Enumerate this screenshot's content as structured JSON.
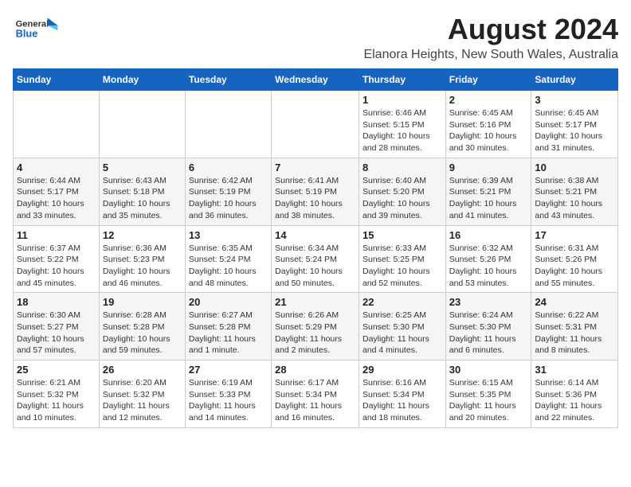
{
  "logo": {
    "text_general": "General",
    "text_blue": "Blue"
  },
  "title": "August 2024",
  "subtitle": "Elanora Heights, New South Wales, Australia",
  "days_of_week": [
    "Sunday",
    "Monday",
    "Tuesday",
    "Wednesday",
    "Thursday",
    "Friday",
    "Saturday"
  ],
  "weeks": [
    [
      {
        "day": "",
        "info": ""
      },
      {
        "day": "",
        "info": ""
      },
      {
        "day": "",
        "info": ""
      },
      {
        "day": "",
        "info": ""
      },
      {
        "day": "1",
        "info": "Sunrise: 6:46 AM\nSunset: 5:15 PM\nDaylight: 10 hours\nand 28 minutes."
      },
      {
        "day": "2",
        "info": "Sunrise: 6:45 AM\nSunset: 5:16 PM\nDaylight: 10 hours\nand 30 minutes."
      },
      {
        "day": "3",
        "info": "Sunrise: 6:45 AM\nSunset: 5:17 PM\nDaylight: 10 hours\nand 31 minutes."
      }
    ],
    [
      {
        "day": "4",
        "info": "Sunrise: 6:44 AM\nSunset: 5:17 PM\nDaylight: 10 hours\nand 33 minutes."
      },
      {
        "day": "5",
        "info": "Sunrise: 6:43 AM\nSunset: 5:18 PM\nDaylight: 10 hours\nand 35 minutes."
      },
      {
        "day": "6",
        "info": "Sunrise: 6:42 AM\nSunset: 5:19 PM\nDaylight: 10 hours\nand 36 minutes."
      },
      {
        "day": "7",
        "info": "Sunrise: 6:41 AM\nSunset: 5:19 PM\nDaylight: 10 hours\nand 38 minutes."
      },
      {
        "day": "8",
        "info": "Sunrise: 6:40 AM\nSunset: 5:20 PM\nDaylight: 10 hours\nand 39 minutes."
      },
      {
        "day": "9",
        "info": "Sunrise: 6:39 AM\nSunset: 5:21 PM\nDaylight: 10 hours\nand 41 minutes."
      },
      {
        "day": "10",
        "info": "Sunrise: 6:38 AM\nSunset: 5:21 PM\nDaylight: 10 hours\nand 43 minutes."
      }
    ],
    [
      {
        "day": "11",
        "info": "Sunrise: 6:37 AM\nSunset: 5:22 PM\nDaylight: 10 hours\nand 45 minutes."
      },
      {
        "day": "12",
        "info": "Sunrise: 6:36 AM\nSunset: 5:23 PM\nDaylight: 10 hours\nand 46 minutes."
      },
      {
        "day": "13",
        "info": "Sunrise: 6:35 AM\nSunset: 5:24 PM\nDaylight: 10 hours\nand 48 minutes."
      },
      {
        "day": "14",
        "info": "Sunrise: 6:34 AM\nSunset: 5:24 PM\nDaylight: 10 hours\nand 50 minutes."
      },
      {
        "day": "15",
        "info": "Sunrise: 6:33 AM\nSunset: 5:25 PM\nDaylight: 10 hours\nand 52 minutes."
      },
      {
        "day": "16",
        "info": "Sunrise: 6:32 AM\nSunset: 5:26 PM\nDaylight: 10 hours\nand 53 minutes."
      },
      {
        "day": "17",
        "info": "Sunrise: 6:31 AM\nSunset: 5:26 PM\nDaylight: 10 hours\nand 55 minutes."
      }
    ],
    [
      {
        "day": "18",
        "info": "Sunrise: 6:30 AM\nSunset: 5:27 PM\nDaylight: 10 hours\nand 57 minutes."
      },
      {
        "day": "19",
        "info": "Sunrise: 6:28 AM\nSunset: 5:28 PM\nDaylight: 10 hours\nand 59 minutes."
      },
      {
        "day": "20",
        "info": "Sunrise: 6:27 AM\nSunset: 5:28 PM\nDaylight: 11 hours\nand 1 minute."
      },
      {
        "day": "21",
        "info": "Sunrise: 6:26 AM\nSunset: 5:29 PM\nDaylight: 11 hours\nand 2 minutes."
      },
      {
        "day": "22",
        "info": "Sunrise: 6:25 AM\nSunset: 5:30 PM\nDaylight: 11 hours\nand 4 minutes."
      },
      {
        "day": "23",
        "info": "Sunrise: 6:24 AM\nSunset: 5:30 PM\nDaylight: 11 hours\nand 6 minutes."
      },
      {
        "day": "24",
        "info": "Sunrise: 6:22 AM\nSunset: 5:31 PM\nDaylight: 11 hours\nand 8 minutes."
      }
    ],
    [
      {
        "day": "25",
        "info": "Sunrise: 6:21 AM\nSunset: 5:32 PM\nDaylight: 11 hours\nand 10 minutes."
      },
      {
        "day": "26",
        "info": "Sunrise: 6:20 AM\nSunset: 5:32 PM\nDaylight: 11 hours\nand 12 minutes."
      },
      {
        "day": "27",
        "info": "Sunrise: 6:19 AM\nSunset: 5:33 PM\nDaylight: 11 hours\nand 14 minutes."
      },
      {
        "day": "28",
        "info": "Sunrise: 6:17 AM\nSunset: 5:34 PM\nDaylight: 11 hours\nand 16 minutes."
      },
      {
        "day": "29",
        "info": "Sunrise: 6:16 AM\nSunset: 5:34 PM\nDaylight: 11 hours\nand 18 minutes."
      },
      {
        "day": "30",
        "info": "Sunrise: 6:15 AM\nSunset: 5:35 PM\nDaylight: 11 hours\nand 20 minutes."
      },
      {
        "day": "31",
        "info": "Sunrise: 6:14 AM\nSunset: 5:36 PM\nDaylight: 11 hours\nand 22 minutes."
      }
    ]
  ]
}
